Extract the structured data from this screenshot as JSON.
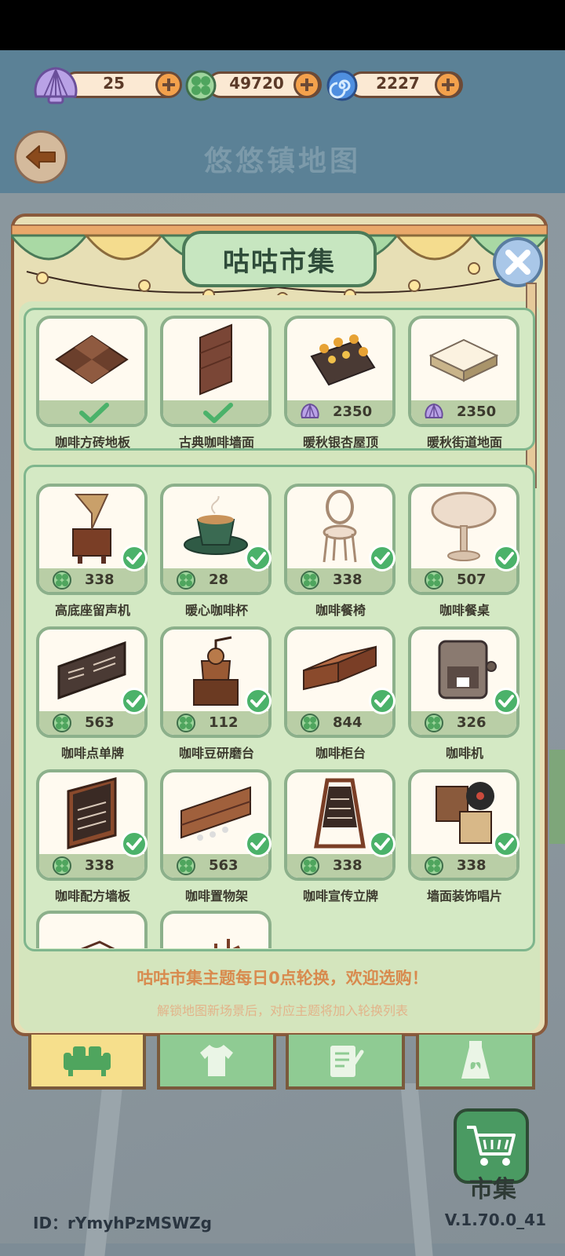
{
  "currencies": [
    {
      "icon": "shell-icon",
      "value": "25"
    },
    {
      "icon": "clover-coin-icon",
      "value": "49720"
    },
    {
      "icon": "spiral-gem-icon",
      "value": "2227"
    }
  ],
  "header": {
    "title": "悠悠镇地图",
    "back_icon": "back-arrow-icon"
  },
  "panel": {
    "title": "咕咕市集",
    "close_icon": "close-icon"
  },
  "theme_items": [
    {
      "label": "咖啡方砖地板",
      "owned": true,
      "price": ""
    },
    {
      "label": "古典咖啡墙面",
      "owned": true,
      "price": ""
    },
    {
      "label": "暖秋银杏屋顶",
      "owned": false,
      "price": "2350",
      "currency": "shell"
    },
    {
      "label": "暖秋街道地面",
      "owned": false,
      "price": "2350",
      "currency": "shell"
    }
  ],
  "furniture_items": [
    {
      "label": "高底座留声机",
      "price": "338",
      "owned": true
    },
    {
      "label": "暖心咖啡杯",
      "price": "28",
      "owned": true
    },
    {
      "label": "咖啡餐椅",
      "price": "338",
      "owned": true
    },
    {
      "label": "咖啡餐桌",
      "price": "507",
      "owned": true
    },
    {
      "label": "咖啡点单牌",
      "price": "563",
      "owned": true
    },
    {
      "label": "咖啡豆研磨台",
      "price": "112",
      "owned": true
    },
    {
      "label": "咖啡柜台",
      "price": "844",
      "owned": true
    },
    {
      "label": "咖啡机",
      "price": "326",
      "owned": true
    },
    {
      "label": "咖啡配方墙板",
      "price": "338",
      "owned": true
    },
    {
      "label": "咖啡置物架",
      "price": "563",
      "owned": true
    },
    {
      "label": "咖啡宣传立牌",
      "price": "338",
      "owned": true
    },
    {
      "label": "墙面装饰唱片",
      "price": "338",
      "owned": true
    }
  ],
  "notice": {
    "main": "咕咕市集主题每日0点轮换，欢迎选购！",
    "sub": "解锁地图新场景后，对应主题将加入轮换列表"
  },
  "tabs": [
    {
      "icon": "sofa-icon",
      "active": true
    },
    {
      "icon": "shirt-icon",
      "active": false
    },
    {
      "icon": "note-icon",
      "active": false
    },
    {
      "icon": "bottle-icon",
      "active": false
    }
  ],
  "market_button": {
    "label": "市集",
    "icon": "shopping-cart-icon"
  },
  "footer": {
    "id": "ID：rYmyhPzMSWZg",
    "version": "V.1.70.0_41"
  },
  "colors": {
    "accent_green": "#4a9a62",
    "accent_orange": "#f3a14c",
    "panel_bg": "#e7dfb5"
  }
}
